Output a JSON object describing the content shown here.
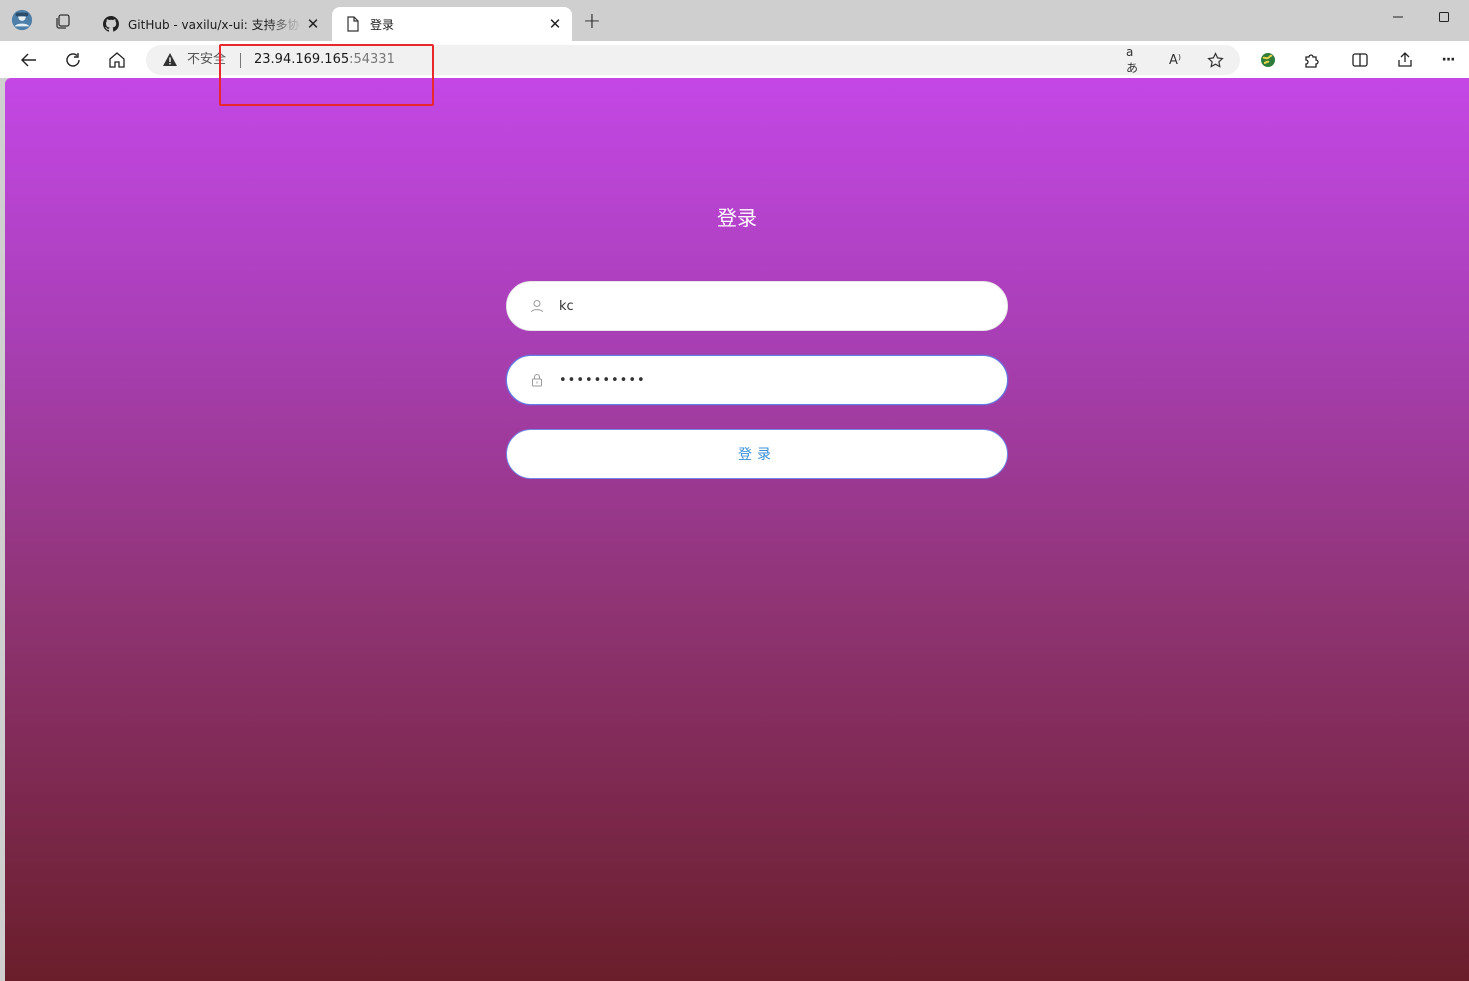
{
  "browser": {
    "tabs": [
      {
        "title": "GitHub - vaxilu/x-ui: 支持多协议多",
        "icon": "github-icon",
        "active": false
      },
      {
        "title": "登录",
        "icon": "page-icon",
        "active": true
      }
    ],
    "address": {
      "security_label": "不安全",
      "host": "23.94.169.165",
      "port": ":54331"
    },
    "icons": {
      "profile": "profile-avatar-icon",
      "collections": "collections-icon",
      "back": "back-arrow-icon",
      "refresh": "refresh-icon",
      "home": "home-icon",
      "read_aloud": "read-aloud-icon",
      "translate": "translate-icon",
      "favorite": "star-icon",
      "extensions": "puzzle-icon",
      "split": "split-screen-icon",
      "share": "share-icon",
      "more": "more-icon"
    },
    "translate_glyph": "aあ",
    "read_glyph": "A⁾",
    "new_tab_glyph": "+",
    "close_glyph": "✕",
    "more_glyph": "···"
  },
  "login": {
    "title": "登录",
    "username_value": "kc",
    "password_value": "••••••••••",
    "submit_label": "登录"
  },
  "colors": {
    "gradient_top": "#c447e6",
    "gradient_bottom": "#6a1e2a",
    "highlight": "#e8282b",
    "accent": "#3b8fd8"
  }
}
